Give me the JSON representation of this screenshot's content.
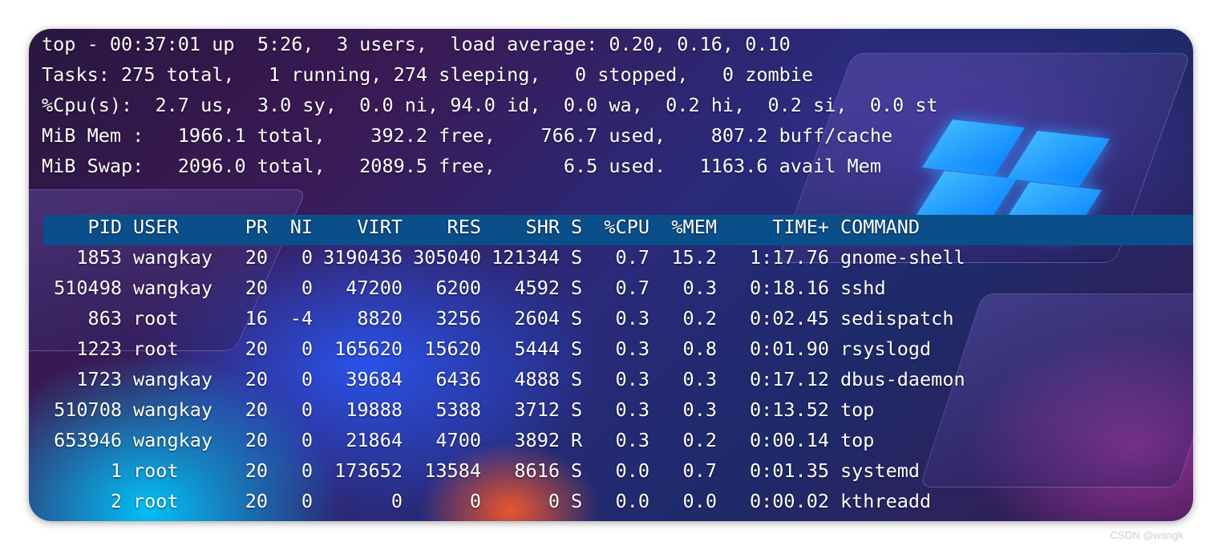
{
  "summary": {
    "line1": "top - 00:37:01 up  5:26,  3 users,  load average: 0.20, 0.16, 0.10",
    "line2": "Tasks: 275 total,   1 running, 274 sleeping,   0 stopped,   0 zombie",
    "line3": "%Cpu(s):  2.7 us,  3.0 sy,  0.0 ni, 94.0 id,  0.0 wa,  0.2 hi,  0.2 si,  0.0 st",
    "line4": "MiB Mem :   1966.1 total,    392.2 free,    766.7 used,    807.2 buff/cache",
    "line5": "MiB Swap:   2096.0 total,   2089.5 free,      6.5 used.   1163.6 avail Mem"
  },
  "table": {
    "headers": {
      "pid": "PID",
      "user": "USER",
      "pr": "PR",
      "ni": "NI",
      "virt": "VIRT",
      "res": "RES",
      "shr": "SHR",
      "s": "S",
      "cpu": "%CPU",
      "mem": "%MEM",
      "time": "TIME+",
      "command": "COMMAND"
    },
    "rows": [
      {
        "pid": "1853",
        "user": "wangkay",
        "pr": "20",
        "ni": "0",
        "virt": "3190436",
        "res": "305040",
        "shr": "121344",
        "s": "S",
        "cpu": "0.7",
        "mem": "15.2",
        "time": "1:17.76",
        "command": "gnome-shell"
      },
      {
        "pid": "510498",
        "user": "wangkay",
        "pr": "20",
        "ni": "0",
        "virt": "47200",
        "res": "6200",
        "shr": "4592",
        "s": "S",
        "cpu": "0.7",
        "mem": "0.3",
        "time": "0:18.16",
        "command": "sshd"
      },
      {
        "pid": "863",
        "user": "root",
        "pr": "16",
        "ni": "-4",
        "virt": "8820",
        "res": "3256",
        "shr": "2604",
        "s": "S",
        "cpu": "0.3",
        "mem": "0.2",
        "time": "0:02.45",
        "command": "sedispatch"
      },
      {
        "pid": "1223",
        "user": "root",
        "pr": "20",
        "ni": "0",
        "virt": "165620",
        "res": "15620",
        "shr": "5444",
        "s": "S",
        "cpu": "0.3",
        "mem": "0.8",
        "time": "0:01.90",
        "command": "rsyslogd"
      },
      {
        "pid": "1723",
        "user": "wangkay",
        "pr": "20",
        "ni": "0",
        "virt": "39684",
        "res": "6436",
        "shr": "4888",
        "s": "S",
        "cpu": "0.3",
        "mem": "0.3",
        "time": "0:17.12",
        "command": "dbus-daemon"
      },
      {
        "pid": "510708",
        "user": "wangkay",
        "pr": "20",
        "ni": "0",
        "virt": "19888",
        "res": "5388",
        "shr": "3712",
        "s": "S",
        "cpu": "0.3",
        "mem": "0.3",
        "time": "0:13.52",
        "command": "top"
      },
      {
        "pid": "653946",
        "user": "wangkay",
        "pr": "20",
        "ni": "0",
        "virt": "21864",
        "res": "4700",
        "shr": "3892",
        "s": "R",
        "cpu": "0.3",
        "mem": "0.2",
        "time": "0:00.14",
        "command": "top"
      },
      {
        "pid": "1",
        "user": "root",
        "pr": "20",
        "ni": "0",
        "virt": "173652",
        "res": "13584",
        "shr": "8616",
        "s": "S",
        "cpu": "0.0",
        "mem": "0.7",
        "time": "0:01.35",
        "command": "systemd"
      },
      {
        "pid": "2",
        "user": "root",
        "pr": "20",
        "ni": "0",
        "virt": "0",
        "res": "0",
        "shr": "0",
        "s": "S",
        "cpu": "0.0",
        "mem": "0.0",
        "time": "0:00.02",
        "command": "kthreadd"
      }
    ]
  },
  "watermark": "CSDN @wangk"
}
